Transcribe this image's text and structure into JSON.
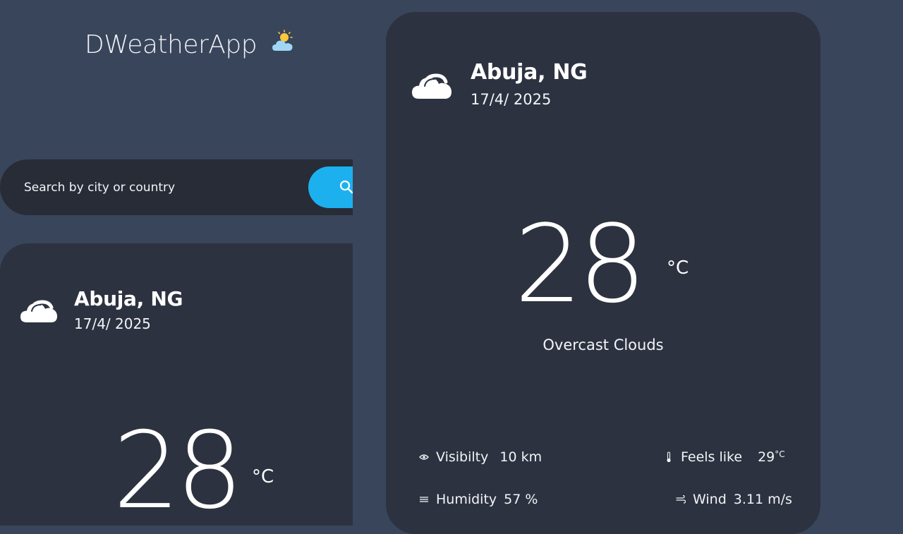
{
  "app": {
    "title": "DWeatherApp",
    "logo_icon": "sun-behind-cloud-icon"
  },
  "search": {
    "placeholder": "Search by city or country",
    "button_icon": "search-icon"
  },
  "left_card": {
    "city": "Abuja, NG",
    "date": "17/4/ 2025",
    "weather_icon": "cloud-icon",
    "temperature": "28",
    "unit": "°C"
  },
  "right_card": {
    "city": "Abuja, NG",
    "date": "17/4/ 2025",
    "weather_icon": "cloud-icon",
    "temperature": "28",
    "unit": "°C",
    "condition": "Overcast Clouds",
    "details": {
      "visibility": {
        "label": "Visibilty",
        "value": "10 km",
        "icon": "eye-icon"
      },
      "feels_like": {
        "label": "Feels like",
        "value": "29",
        "unit": "°C",
        "icon": "thermometer-icon"
      },
      "humidity": {
        "label": "Humidity",
        "value": "57 %",
        "icon": "humidity-icon"
      },
      "wind": {
        "label": "Wind",
        "value": "3.11 m/s",
        "icon": "wind-icon"
      }
    }
  },
  "colors": {
    "background": "#39455a",
    "card": "#2d3240",
    "search_bar": "#272c37",
    "accent": "#1cb1ee"
  }
}
